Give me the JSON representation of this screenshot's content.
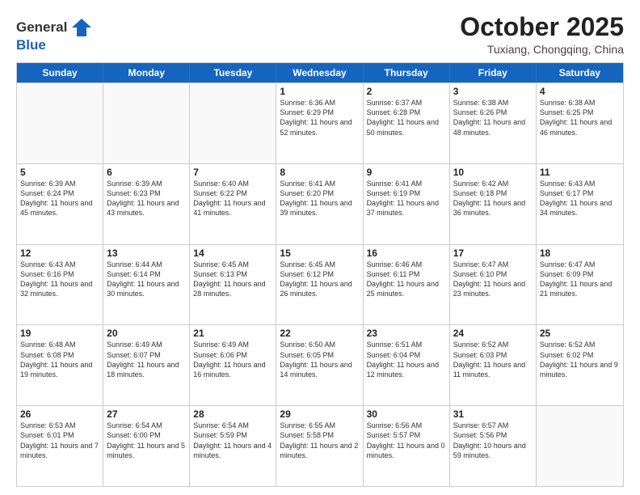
{
  "header": {
    "logo_general": "General",
    "logo_blue": "Blue",
    "month": "October 2025",
    "location": "Tuxiang, Chongqing, China"
  },
  "weekdays": [
    "Sunday",
    "Monday",
    "Tuesday",
    "Wednesday",
    "Thursday",
    "Friday",
    "Saturday"
  ],
  "weeks": [
    [
      {
        "day": "",
        "info": ""
      },
      {
        "day": "",
        "info": ""
      },
      {
        "day": "",
        "info": ""
      },
      {
        "day": "1",
        "info": "Sunrise: 6:36 AM\nSunset: 6:29 PM\nDaylight: 11 hours\nand 52 minutes."
      },
      {
        "day": "2",
        "info": "Sunrise: 6:37 AM\nSunset: 6:28 PM\nDaylight: 11 hours\nand 50 minutes."
      },
      {
        "day": "3",
        "info": "Sunrise: 6:38 AM\nSunset: 6:26 PM\nDaylight: 11 hours\nand 48 minutes."
      },
      {
        "day": "4",
        "info": "Sunrise: 6:38 AM\nSunset: 6:25 PM\nDaylight: 11 hours\nand 46 minutes."
      }
    ],
    [
      {
        "day": "5",
        "info": "Sunrise: 6:39 AM\nSunset: 6:24 PM\nDaylight: 11 hours\nand 45 minutes."
      },
      {
        "day": "6",
        "info": "Sunrise: 6:39 AM\nSunset: 6:23 PM\nDaylight: 11 hours\nand 43 minutes."
      },
      {
        "day": "7",
        "info": "Sunrise: 6:40 AM\nSunset: 6:22 PM\nDaylight: 11 hours\nand 41 minutes."
      },
      {
        "day": "8",
        "info": "Sunrise: 6:41 AM\nSunset: 6:20 PM\nDaylight: 11 hours\nand 39 minutes."
      },
      {
        "day": "9",
        "info": "Sunrise: 6:41 AM\nSunset: 6:19 PM\nDaylight: 11 hours\nand 37 minutes."
      },
      {
        "day": "10",
        "info": "Sunrise: 6:42 AM\nSunset: 6:18 PM\nDaylight: 11 hours\nand 36 minutes."
      },
      {
        "day": "11",
        "info": "Sunrise: 6:43 AM\nSunset: 6:17 PM\nDaylight: 11 hours\nand 34 minutes."
      }
    ],
    [
      {
        "day": "12",
        "info": "Sunrise: 6:43 AM\nSunset: 6:16 PM\nDaylight: 11 hours\nand 32 minutes."
      },
      {
        "day": "13",
        "info": "Sunrise: 6:44 AM\nSunset: 6:14 PM\nDaylight: 11 hours\nand 30 minutes."
      },
      {
        "day": "14",
        "info": "Sunrise: 6:45 AM\nSunset: 6:13 PM\nDaylight: 11 hours\nand 28 minutes."
      },
      {
        "day": "15",
        "info": "Sunrise: 6:45 AM\nSunset: 6:12 PM\nDaylight: 11 hours\nand 26 minutes."
      },
      {
        "day": "16",
        "info": "Sunrise: 6:46 AM\nSunset: 6:11 PM\nDaylight: 11 hours\nand 25 minutes."
      },
      {
        "day": "17",
        "info": "Sunrise: 6:47 AM\nSunset: 6:10 PM\nDaylight: 11 hours\nand 23 minutes."
      },
      {
        "day": "18",
        "info": "Sunrise: 6:47 AM\nSunset: 6:09 PM\nDaylight: 11 hours\nand 21 minutes."
      }
    ],
    [
      {
        "day": "19",
        "info": "Sunrise: 6:48 AM\nSunset: 6:08 PM\nDaylight: 11 hours\nand 19 minutes."
      },
      {
        "day": "20",
        "info": "Sunrise: 6:49 AM\nSunset: 6:07 PM\nDaylight: 11 hours\nand 18 minutes."
      },
      {
        "day": "21",
        "info": "Sunrise: 6:49 AM\nSunset: 6:06 PM\nDaylight: 11 hours\nand 16 minutes."
      },
      {
        "day": "22",
        "info": "Sunrise: 6:50 AM\nSunset: 6:05 PM\nDaylight: 11 hours\nand 14 minutes."
      },
      {
        "day": "23",
        "info": "Sunrise: 6:51 AM\nSunset: 6:04 PM\nDaylight: 11 hours\nand 12 minutes."
      },
      {
        "day": "24",
        "info": "Sunrise: 6:52 AM\nSunset: 6:03 PM\nDaylight: 11 hours\nand 11 minutes."
      },
      {
        "day": "25",
        "info": "Sunrise: 6:52 AM\nSunset: 6:02 PM\nDaylight: 11 hours\nand 9 minutes."
      }
    ],
    [
      {
        "day": "26",
        "info": "Sunrise: 6:53 AM\nSunset: 6:01 PM\nDaylight: 11 hours\nand 7 minutes."
      },
      {
        "day": "27",
        "info": "Sunrise: 6:54 AM\nSunset: 6:00 PM\nDaylight: 11 hours\nand 5 minutes."
      },
      {
        "day": "28",
        "info": "Sunrise: 6:54 AM\nSunset: 5:59 PM\nDaylight: 11 hours\nand 4 minutes."
      },
      {
        "day": "29",
        "info": "Sunrise: 6:55 AM\nSunset: 5:58 PM\nDaylight: 11 hours\nand 2 minutes."
      },
      {
        "day": "30",
        "info": "Sunrise: 6:56 AM\nSunset: 5:57 PM\nDaylight: 11 hours\nand 0 minutes."
      },
      {
        "day": "31",
        "info": "Sunrise: 6:57 AM\nSunset: 5:56 PM\nDaylight: 10 hours\nand 59 minutes."
      },
      {
        "day": "",
        "info": ""
      }
    ]
  ]
}
